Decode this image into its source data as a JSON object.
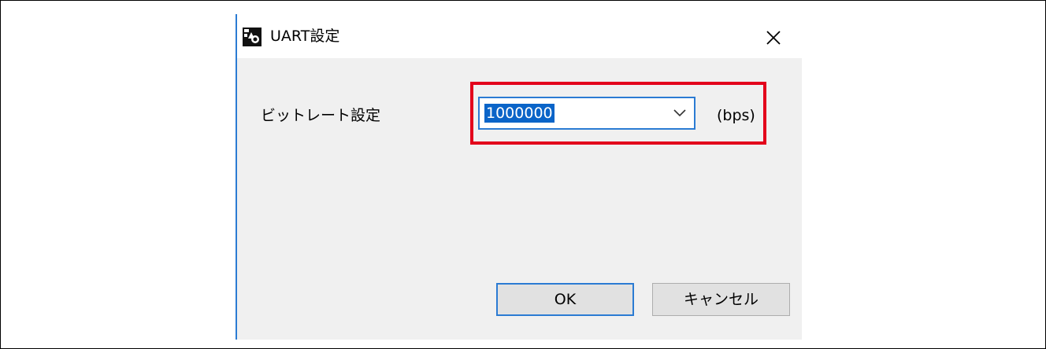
{
  "window": {
    "title": "UART設定",
    "icon": "app-icon",
    "close_icon": "close-icon"
  },
  "form": {
    "bitrate_label": "ビットレート設定",
    "bitrate_value": "1000000",
    "bitrate_units": "(bps)",
    "dropdown_icon": "chevron-down-icon"
  },
  "buttons": {
    "ok_label": "OK",
    "cancel_label": "キャンセル"
  },
  "colors": {
    "highlight": "#e3001b",
    "focus_accent": "#2b7bd3",
    "selection": "#0a64c8",
    "dialog_background": "#f0f0f0"
  }
}
